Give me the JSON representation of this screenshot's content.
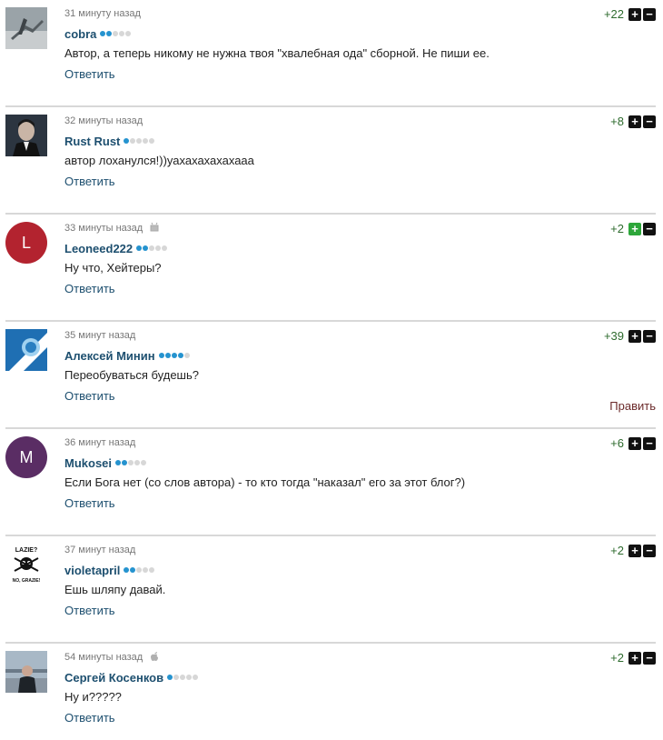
{
  "comments": [
    {
      "time": "31 минуту назад",
      "author": "cobra",
      "level": 2,
      "text": "Автор, а теперь никому не нужна твоя \"хвалебная ода\" сборной. Не пиши ее.",
      "reply": "Ответить",
      "score": "+22",
      "avatar_icon": "photo-avatar-icon",
      "device_icon": ""
    },
    {
      "time": "32 минуты назад",
      "author": "Rust Rust",
      "level": 1,
      "text": "автор лоханулся!))уахахахахахааа",
      "reply": "Ответить",
      "score": "+8",
      "avatar_icon": "photo-avatar-icon",
      "device_icon": ""
    },
    {
      "time": "33 минуты назад",
      "author": "Leoneed222",
      "level": 2,
      "text": "Ну что, Хейтеры?",
      "reply": "Ответить",
      "score": "+2",
      "avatar_letter": "L",
      "avatar_color": "#b3232f",
      "device_icon": "android-icon",
      "upvoted": true
    },
    {
      "time": "35 минут назад",
      "author": "Алексей Минин",
      "level": 4,
      "text": "Переобуваться будешь?",
      "reply": "Ответить",
      "edit": "Править",
      "score": "+39",
      "avatar_icon": "club-logo-icon",
      "device_icon": ""
    },
    {
      "time": "36 минут назад",
      "author": "Mukosei",
      "level": 2,
      "text": "Если Бога нет (со слов автора) - то кто тогда \"наказал\" его за этот блог?)",
      "reply": "Ответить",
      "score": "+6",
      "avatar_letter": "M",
      "avatar_color": "#5a2d64",
      "device_icon": ""
    },
    {
      "time": "37 минут назад",
      "author": "violetapril",
      "level": 2,
      "text": "Ешь шляпу давай.",
      "reply": "Ответить",
      "score": "+2",
      "avatar_icon": "lazie-image-icon",
      "avatar_text_top": "LAZIE?",
      "avatar_text_bottom": "NO, GRAZIE!",
      "device_icon": ""
    },
    {
      "time": "54 минуты назад",
      "author": "Сергей Косенков",
      "level": 1,
      "text": "Ну и?????",
      "reply": "Ответить",
      "score": "+2",
      "avatar_icon": "photo-avatar-icon",
      "device_icon": "apple-icon"
    }
  ],
  "vote_labels": {
    "up": "+",
    "down": "−"
  },
  "colors": {
    "author": "#1d4f6f",
    "level_on": "#2593cf",
    "score": "#2e6b2e",
    "edit": "#6b2a2a"
  }
}
